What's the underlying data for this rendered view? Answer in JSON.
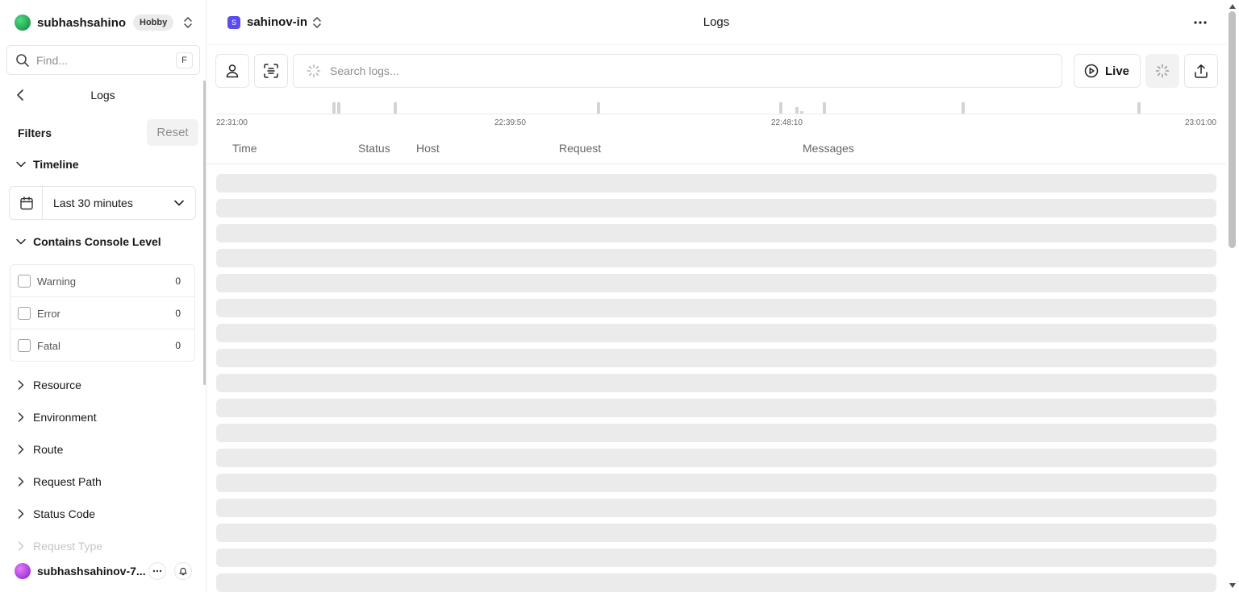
{
  "sidebar": {
    "team_name": "subhashsahino...",
    "plan_badge": "Hobby",
    "find_placeholder": "Find...",
    "find_shortcut": "F",
    "back_title": "Logs",
    "filters_title": "Filters",
    "reset_label": "Reset",
    "timeline": {
      "label": "Timeline",
      "selected": "Last 30 minutes"
    },
    "console_level": {
      "label": "Contains Console Level",
      "levels": [
        {
          "label": "Warning",
          "count": "0"
        },
        {
          "label": "Error",
          "count": "0"
        },
        {
          "label": "Fatal",
          "count": "0"
        }
      ]
    },
    "collapsed_filters": [
      "Resource",
      "Environment",
      "Route",
      "Request Path",
      "Status Code",
      "Request Type"
    ],
    "user_name": "subhashsahinov-7..."
  },
  "topbar": {
    "project_initial": "S",
    "project_name": "sahinov-in",
    "page_title": "Logs"
  },
  "toolbar": {
    "search_placeholder": "Search logs...",
    "live_label": "Live"
  },
  "timeline_chart": {
    "ticks": [
      "22:31:00",
      "22:39:50",
      "22:48:10",
      "23:01:00"
    ]
  },
  "table": {
    "columns": [
      "Time",
      "Status",
      "Host",
      "Request",
      "Messages"
    ],
    "loading_rows": 16
  },
  "icons": {
    "user_filter": "user-icon",
    "scan": "scan-icon",
    "loading": "spinner-icon",
    "live": "play-circle-icon",
    "export": "upload-icon",
    "more": "ellipsis-icon",
    "calendar": "calendar-icon",
    "bell": "bell-icon"
  }
}
